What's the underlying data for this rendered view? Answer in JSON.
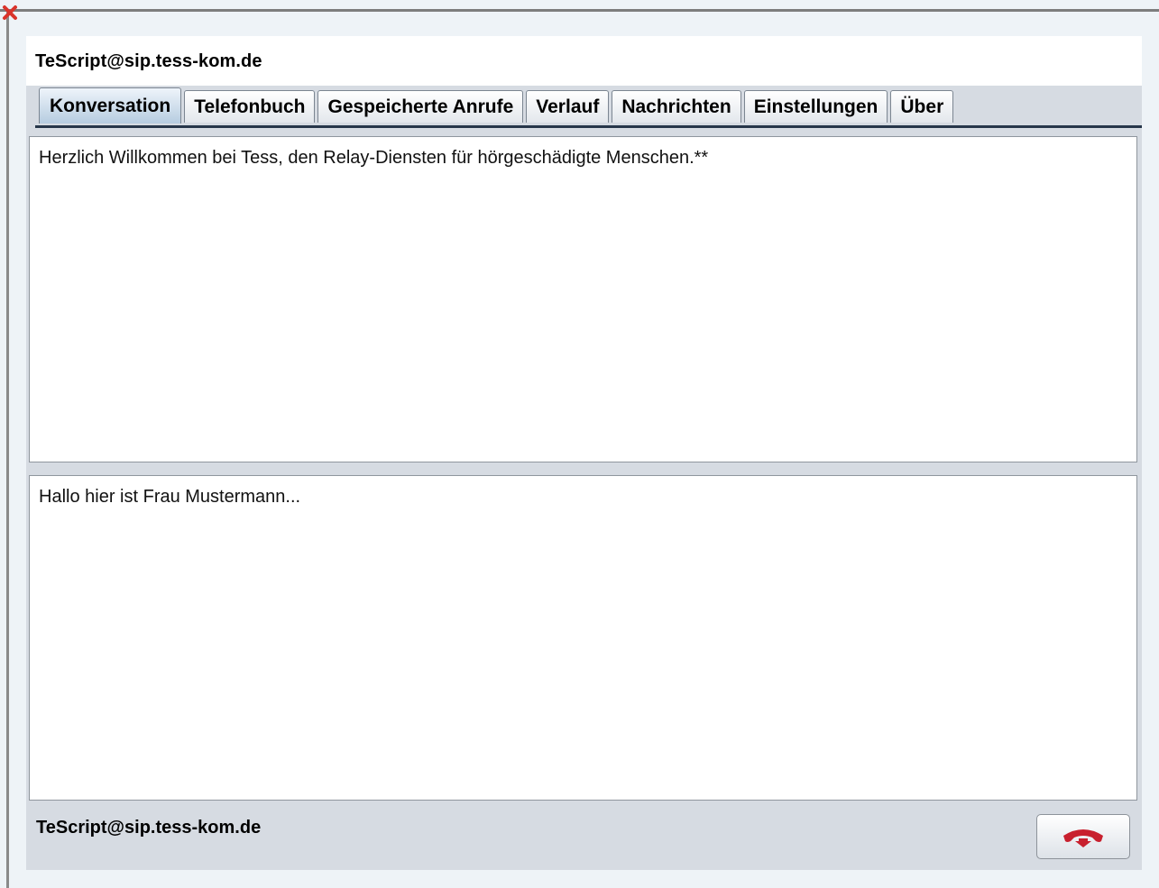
{
  "window": {
    "account": "TeScript@sip.tess-kom.de"
  },
  "tabs": [
    {
      "label": "Konversation",
      "active": true
    },
    {
      "label": "Telefonbuch",
      "active": false
    },
    {
      "label": "Gespeicherte Anrufe",
      "active": false
    },
    {
      "label": "Verlauf",
      "active": false
    },
    {
      "label": "Nachrichten",
      "active": false
    },
    {
      "label": "Einstellungen",
      "active": false
    },
    {
      "label": "Über",
      "active": false
    }
  ],
  "conversation": {
    "incoming_text": "Herzlich Willkommen bei Tess, den Relay-Diensten für hörgeschädigte Menschen.**",
    "outgoing_text": "Hallo hier ist Frau Mustermann..."
  },
  "footer": {
    "account": "TeScript@sip.tess-kom.de",
    "hangup_icon": "hang-up-phone-icon",
    "hangup_color": "#c8202e"
  },
  "colors": {
    "active_tab": "#b6cce0",
    "tab_underline": "#27364a",
    "close_icon": "#d9342b"
  }
}
